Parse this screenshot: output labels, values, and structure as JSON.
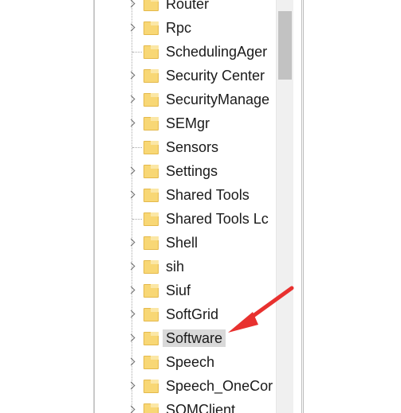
{
  "tree": {
    "nodes": [
      {
        "label": "Router",
        "expandable": true
      },
      {
        "label": "Rpc",
        "expandable": true
      },
      {
        "label": "SchedulingAger",
        "expandable": false
      },
      {
        "label": "Security Center",
        "expandable": true
      },
      {
        "label": "SecurityManage",
        "expandable": true
      },
      {
        "label": "SEMgr",
        "expandable": true
      },
      {
        "label": "Sensors",
        "expandable": false
      },
      {
        "label": "Settings",
        "expandable": true
      },
      {
        "label": "Shared Tools",
        "expandable": true
      },
      {
        "label": "Shared Tools Lc",
        "expandable": false
      },
      {
        "label": "Shell",
        "expandable": true
      },
      {
        "label": "sih",
        "expandable": true
      },
      {
        "label": "Siuf",
        "expandable": true
      },
      {
        "label": "SoftGrid",
        "expandable": true
      },
      {
        "label": "Software",
        "expandable": true,
        "selected": true
      },
      {
        "label": "Speech",
        "expandable": true
      },
      {
        "label": "Speech_OneCor",
        "expandable": true
      },
      {
        "label": "SQMClient",
        "expandable": true
      }
    ]
  },
  "colors": {
    "folder": "#f8d775",
    "selection": "#d9d9d9",
    "annotation_arrow": "#e8312f"
  },
  "icons": {
    "node": "folder-icon",
    "expander": "chevron-right-icon"
  }
}
